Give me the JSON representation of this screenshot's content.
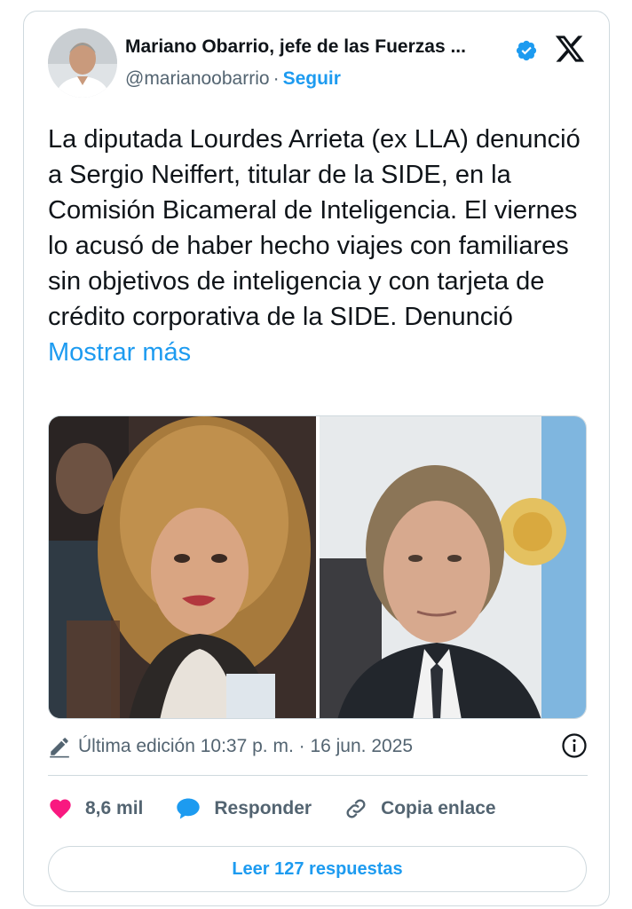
{
  "author": {
    "name": "Mariano Obarrio, jefe de las Fuerzas ...",
    "handle": "@marianoobarrio",
    "separator": "·",
    "follow_label": "Seguir"
  },
  "tweet": {
    "text": "La diputada Lourdes Arrieta (ex LLA) denunció a Sergio Neiffert, titular de la SIDE, en la Comisión Bicameral de Inteligencia. El viernes lo acusó de haber hecho viajes con familiares sin objetivos de inteligencia y con tarjeta de crédito corporativa de la SIDE. Denunció",
    "show_more": "Mostrar más"
  },
  "edit_info": {
    "label": "Última edición 10:37 p. m. · 16 jun. 2025"
  },
  "actions": {
    "likes": "8,6 mil",
    "reply_label": "Responder",
    "copy_link_label": "Copia enlace"
  },
  "read_replies_label": "Leer 127 respuestas",
  "colors": {
    "accent": "#1d9bf0",
    "like": "#f91880",
    "muted": "#536471",
    "border": "#cfd9de"
  },
  "icons": {
    "verified": "verified-badge-icon",
    "logo": "x-logo-icon",
    "edit": "pencil-icon",
    "info": "info-icon",
    "like": "heart-icon",
    "reply": "speech-bubble-icon",
    "link": "link-icon"
  }
}
